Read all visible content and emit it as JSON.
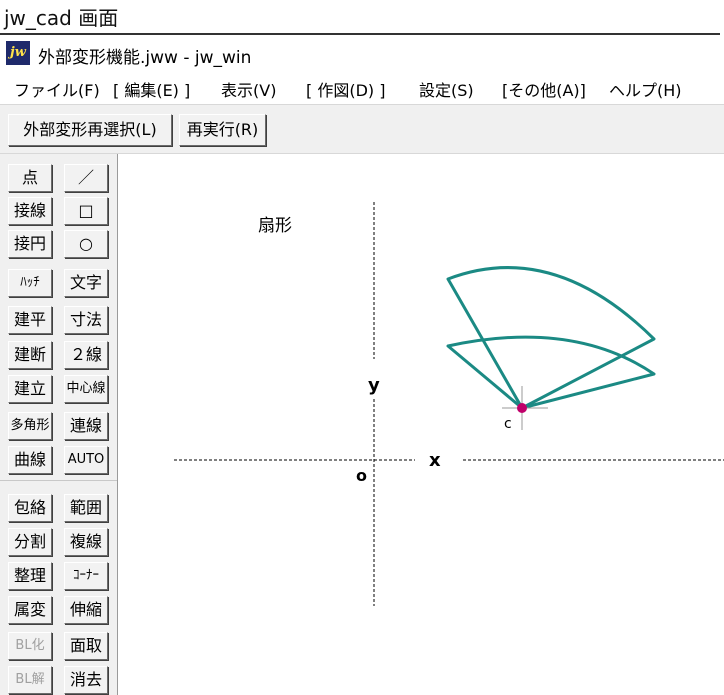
{
  "caption": "jw_cad 画面",
  "window": {
    "icon": "jw",
    "title": "外部変形機能.jww - jw_win"
  },
  "menu": [
    "ファイル(F)",
    "[ 編集(E) ]",
    "表示(V)",
    "[ 作図(D) ]",
    "設定(S)",
    "[その他(A)]",
    "ヘルプ(H)"
  ],
  "toolbar": {
    "reselect": "外部変形再選択(L)",
    "rerun": "再実行(R)"
  },
  "tools": {
    "left": [
      "点",
      "接線",
      "接円",
      "ﾊｯﾁ",
      "建平",
      "建断",
      "建立",
      "多角形",
      "曲線",
      "包絡",
      "分割",
      "整理",
      "属変",
      "BL化",
      "BL解"
    ],
    "right": [
      "／",
      "□",
      "○",
      "文字",
      "寸法",
      "２線",
      "中心線",
      "連線",
      "AUTO",
      "範囲",
      "複線",
      "ｺｰﾅｰ",
      "伸縮",
      "面取",
      "消去"
    ],
    "dimmed": [
      "BL化",
      "BL解"
    ]
  },
  "drawing": {
    "label": "扇形",
    "axis_x": "x",
    "axis_y": "y",
    "origin": "o",
    "center": "c",
    "colors": {
      "sector": "#1b8a84",
      "center_point": "#c0006a",
      "axis": "#000000"
    }
  }
}
